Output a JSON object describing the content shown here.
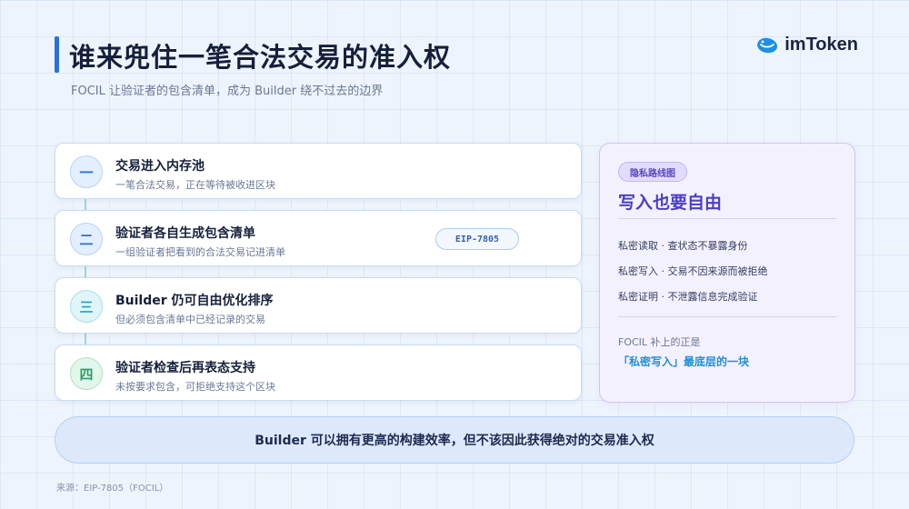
{
  "header": {
    "title": "谁来兜住一笔合法交易的准入权",
    "subtitle": "FOCIL 让验证者的包含清单，成为 Builder 绕不过去的边界"
  },
  "logo": {
    "text": "imToken",
    "icon": "imtoken-whale-icon",
    "color": "#1e8fe8"
  },
  "steps": [
    {
      "badge": "一",
      "title": "交易进入内存池",
      "desc": "一笔合法交易，正在等待被收进区块",
      "color": "blue"
    },
    {
      "badge": "二",
      "title": "验证者各自生成包含清单",
      "desc": "一组验证者把看到的合法交易记进清单",
      "tag": "EIP-7805",
      "color": "blue"
    },
    {
      "badge": "三",
      "title": "Builder 仍可自由优化排序",
      "desc": "但必须包含清单中已经记录的交易",
      "color": "teal"
    },
    {
      "badge": "四",
      "title": "验证者检查后再表态支持",
      "desc": "未按要求包含，可拒绝支持这个区块",
      "color": "green"
    }
  ],
  "side": {
    "tag": "隐私路线图",
    "title": "写入也要自由",
    "items": [
      "私密读取 · 查状态不暴露身份",
      "私密写入 · 交易不因来源而被拒绝",
      "私密证明 · 不泄露信息完成验证"
    ],
    "note": "FOCIL 补上的正是",
    "highlight": "「私密写入」最底层的一块"
  },
  "bottom": {
    "text": "Builder 可以拥有更高的构建效率，但不该因此获得绝对的交易准入权"
  },
  "source": "来源：EIP-7805（FOCIL）"
}
